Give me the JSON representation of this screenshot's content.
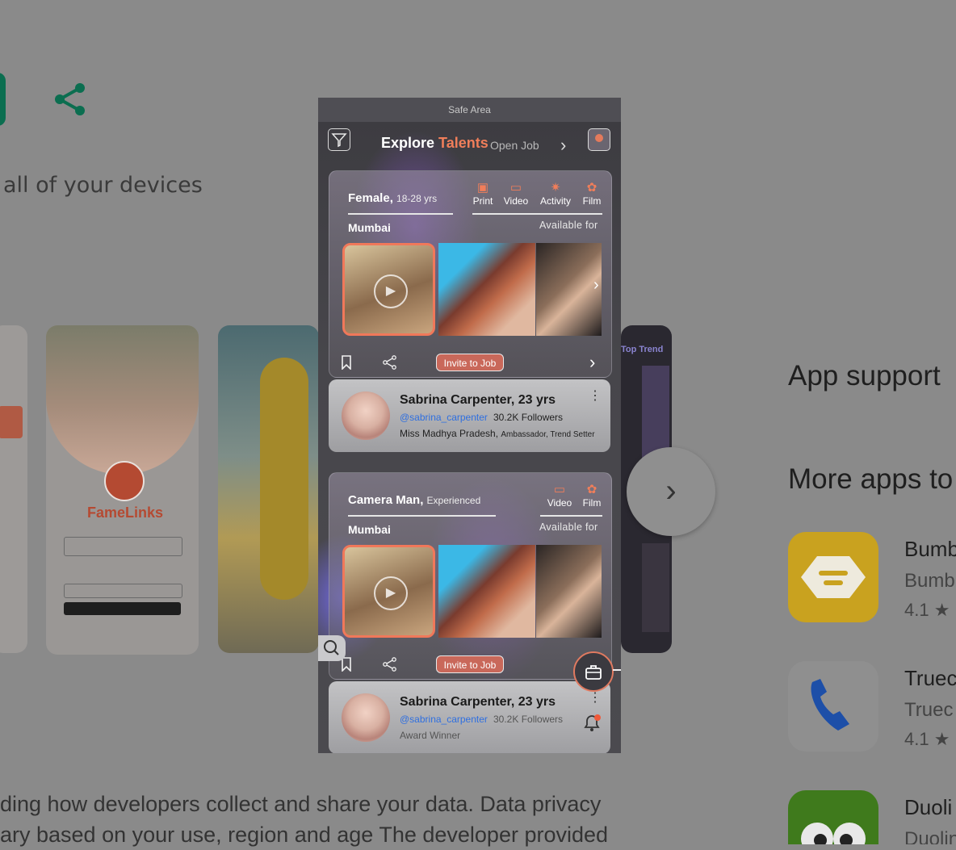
{
  "background": {
    "devices_text": "all of your devices",
    "app_support": "App support",
    "more_apps": "More apps to",
    "apps": [
      {
        "name": "Bumb",
        "sub": "Bumb",
        "rating": "4.1 ★"
      },
      {
        "name": "Truec",
        "sub": "Truec",
        "rating": "4.1 ★"
      },
      {
        "name": "Duoli",
        "sub": "Duolin",
        "rating": ""
      }
    ],
    "body_line1": "ding how developers collect and share your data. Data privacy",
    "body_line2": "ary based on your use, region and age The developer provided",
    "screenshot_brand": "FameLinks",
    "screenshot_trend_label": "Top Trend"
  },
  "phone": {
    "safe_area": "Safe Area",
    "header": {
      "title_main": "Explore ",
      "title_accent": "Talents",
      "subtitle": "Open Job"
    },
    "cards": [
      {
        "title": "Female,",
        "title_detail": "18-28 yrs",
        "city": "Mumbai",
        "available_label": "Available for",
        "categories": [
          "Print",
          "Video",
          "Activity",
          "Film"
        ],
        "invite_label": "Invite to Job",
        "profile": {
          "name": "Sabrina Carpenter, 23 yrs",
          "handle": "@sabrina_carpenter",
          "followers": "30.2K Followers",
          "desc_main": "Miss Madhya Pradesh, ",
          "desc_small": "Ambassador, Trend Setter"
        }
      },
      {
        "title": "Camera Man,",
        "title_detail": "Experienced",
        "city": "Mumbai",
        "available_label": "Available for",
        "categories": [
          "Video",
          "Film"
        ],
        "invite_label": "Invite to Job",
        "profile": {
          "name": "Sabrina Carpenter, 23 yrs",
          "handle": "@sabrina_carpenter",
          "followers": "30.2K Followers",
          "desc_main": "Award Winner",
          "desc_small": ""
        }
      }
    ]
  },
  "icons": {
    "share": "share-icon",
    "bookmark": "bookmark-icon",
    "search": "search-icon",
    "briefcase": "briefcase-icon",
    "bell": "bell-icon"
  },
  "colors": {
    "accent": "#f07e5a",
    "handle": "#2f6fe0",
    "store_green": "#0b7a5a"
  }
}
